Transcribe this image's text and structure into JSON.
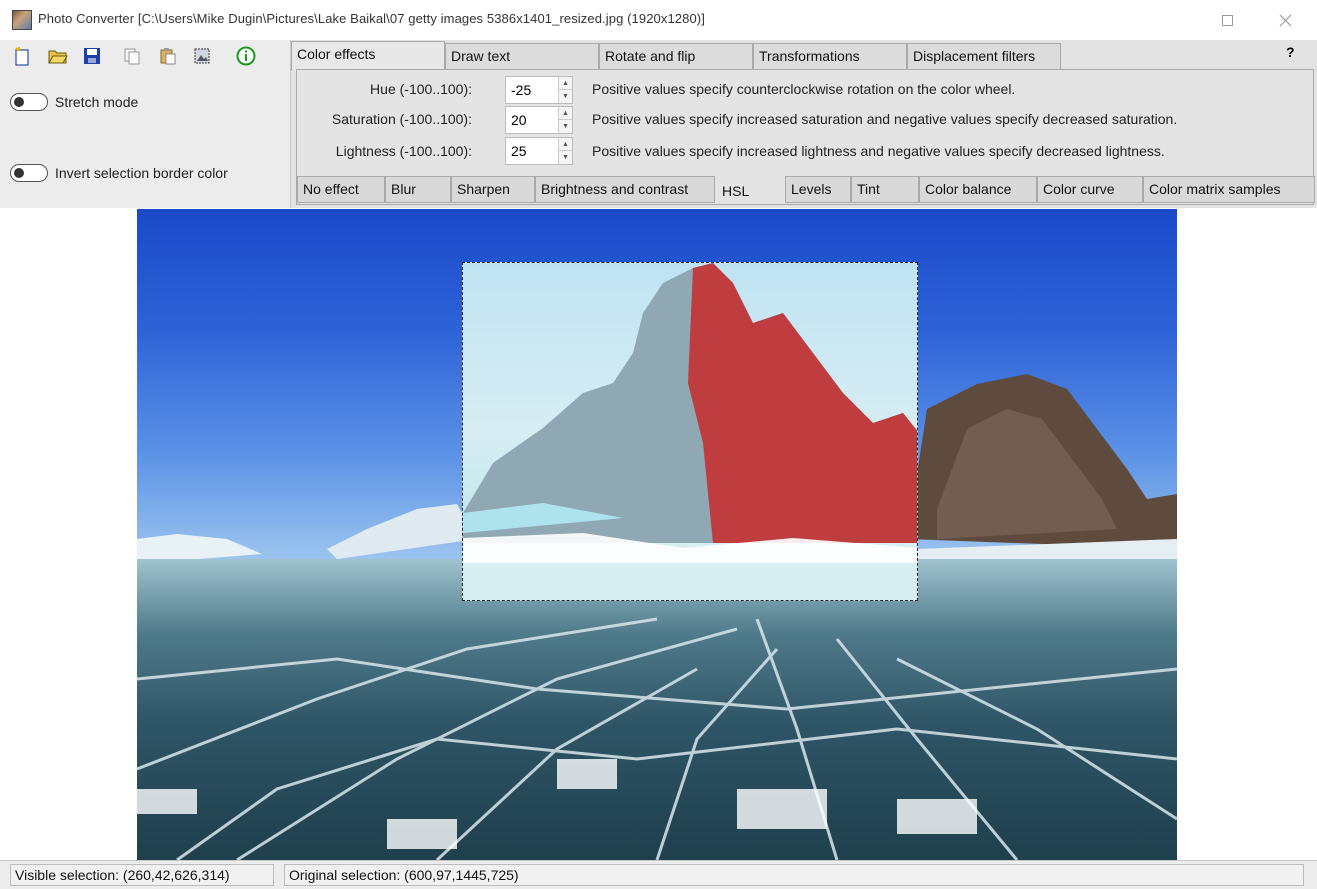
{
  "window": {
    "title": "Photo Converter [C:\\Users\\Mike Dugin\\Pictures\\Lake Baikal\\07 getty images 5386x1401_resized.jpg (1920x1280)]"
  },
  "toolbar": {
    "buttons": [
      "new-icon",
      "open-icon",
      "save-icon",
      "copy-icon",
      "paste-icon",
      "select-icon",
      "info-icon"
    ]
  },
  "toggles": {
    "stretch_mode": "Stretch mode",
    "invert_selection": "Invert selection border color"
  },
  "tabs": {
    "items": [
      "Color effects",
      "Draw text",
      "Rotate and flip",
      "Transformations",
      "Displacement filters"
    ],
    "active": "Color effects",
    "help": "?"
  },
  "params": {
    "hue": {
      "label": "Hue (-100..100):",
      "value": "-25",
      "desc": "Positive values specify counterclockwise rotation on the color wheel."
    },
    "saturation": {
      "label": "Saturation (-100..100):",
      "value": "20",
      "desc": "Positive values specify increased saturation and negative values specify decreased saturation."
    },
    "lightness": {
      "label": "Lightness (-100..100):",
      "value": "25",
      "desc": "Positive values specify increased lightness and negative values specify decreased lightness."
    }
  },
  "subtabs": {
    "items": [
      "No effect",
      "Blur",
      "Sharpen",
      "Brightness and contrast",
      "HSL",
      "Levels",
      "Tint",
      "Color balance",
      "Color curve",
      "Color matrix samples"
    ],
    "active": "HSL"
  },
  "status": {
    "visible": "Visible selection: (260,42,626,314)",
    "original": "Original selection: (600,97,1445,725)"
  }
}
